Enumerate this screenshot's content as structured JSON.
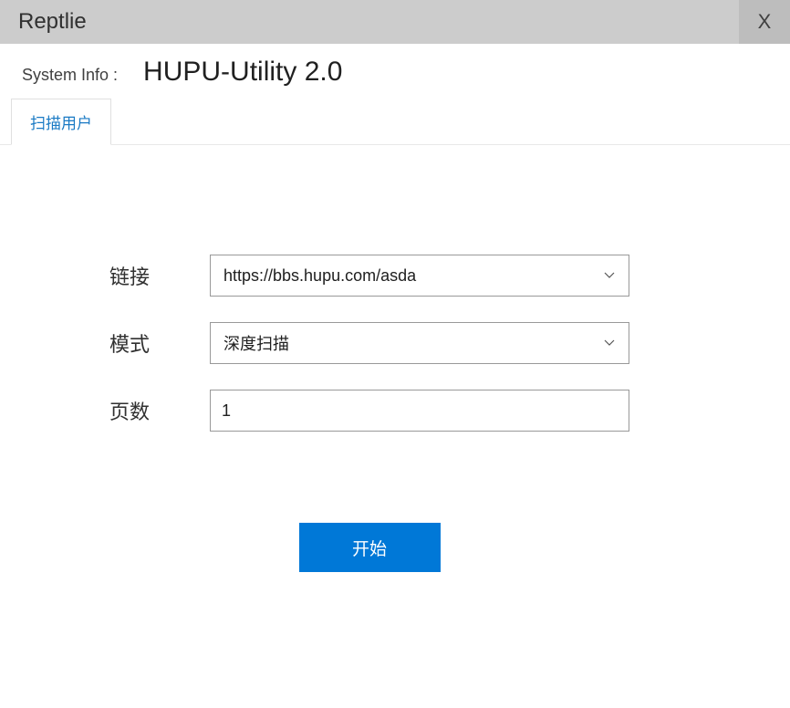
{
  "titlebar": {
    "title": "Reptlie",
    "close": "X"
  },
  "system_info": {
    "label": "System Info :",
    "value": "HUPU-Utility 2.0"
  },
  "tabs": {
    "scan_users_label": "扫描用户"
  },
  "form": {
    "link_label": "链接",
    "link_value": "https://bbs.hupu.com/asda",
    "mode_label": "模式",
    "mode_value": "深度扫描",
    "pages_label": "页数",
    "pages_value": "1"
  },
  "actions": {
    "start_label": "开始"
  }
}
